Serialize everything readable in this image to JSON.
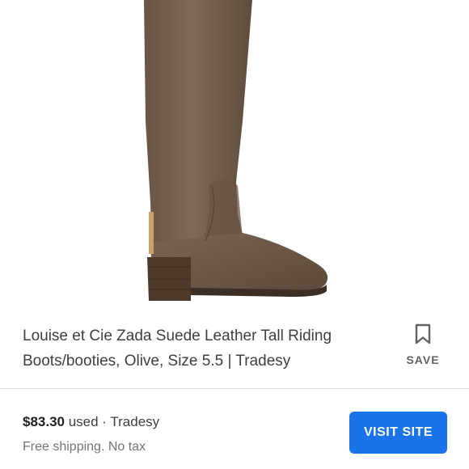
{
  "product": {
    "title": "Louise et Cie Zada Suede Leather Tall Riding Boots/booties, Olive, Size 5.5 | Tradesy",
    "image_icon": "boot-product-image"
  },
  "save": {
    "label": "SAVE",
    "icon": "bookmark-icon"
  },
  "offer": {
    "price": "$83.30",
    "condition": " used · Tradesy",
    "shipping": "Free shipping. No tax",
    "visit_label": "VISIT SITE"
  },
  "colors": {
    "accent": "#1a73e8",
    "boot": "#735f4d",
    "text": "#3c4043",
    "muted": "#70757a"
  }
}
